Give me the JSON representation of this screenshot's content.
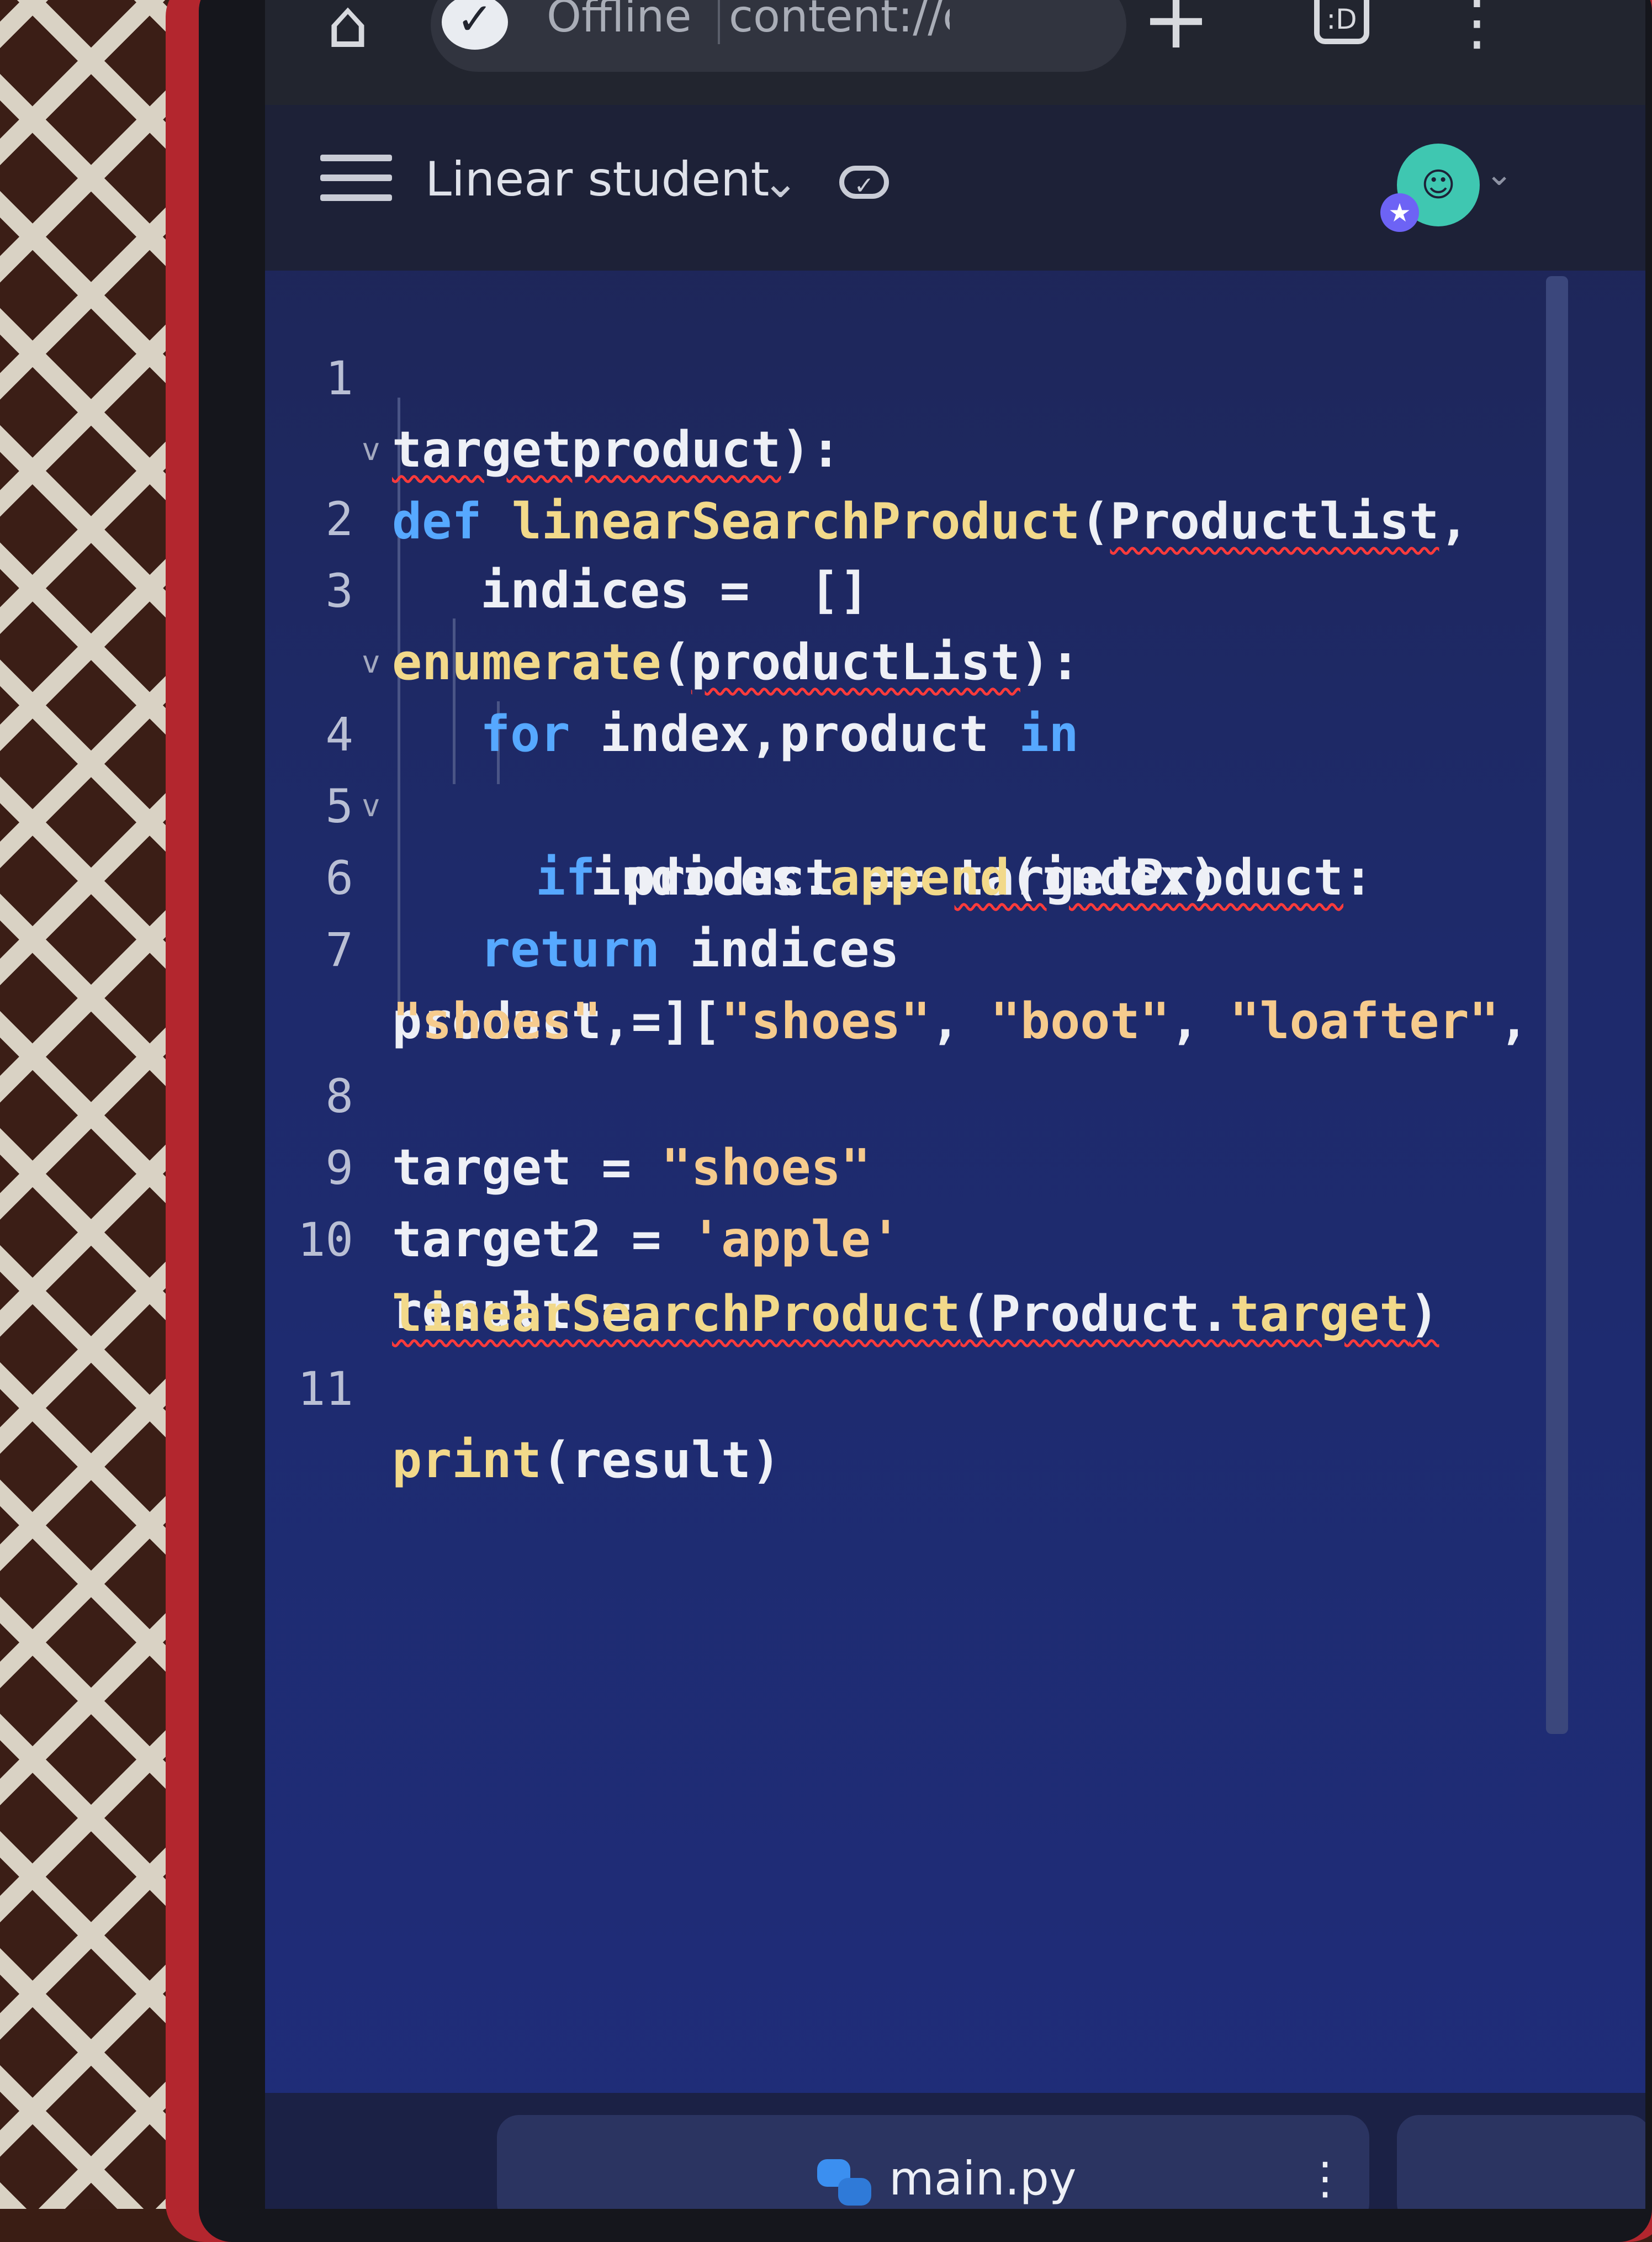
{
  "browser": {
    "status": "Offline",
    "url": "content://com.",
    "home_icon": "home-icon",
    "offline_icon": "check-circle-icon",
    "new_tab_icon": "plus-icon",
    "tabs_icon": "tab-switcher-icon",
    "tabs_count": ":D",
    "more_icon": "more-vert-icon"
  },
  "header": {
    "project_title": "Linear student",
    "menu_icon": "hamburger-icon",
    "dropdown_icon": "chevron-down-icon",
    "sync_icon": "cloud-check-icon"
  },
  "editor": {
    "line_numbers": [
      "1",
      "2",
      "3",
      "4",
      "5",
      "6",
      "7",
      "8",
      "9",
      "10",
      "11"
    ],
    "lines": [
      {
        "no": "1",
        "text": "def linearSearchProduct(Productlist,"
      },
      {
        "no": "",
        "text": "targetproduct):"
      },
      {
        "no": "2",
        "text": "indices = []"
      },
      {
        "no": "3",
        "text": "for index,product in"
      },
      {
        "no": "",
        "text": "enumerate(productList):"
      },
      {
        "no": "4",
        "text": "if product == targetProduct:"
      },
      {
        "no": "5",
        "text": "indices.append(index)"
      },
      {
        "no": "6",
        "text": "return indices"
      },
      {
        "no": "7",
        "text": "product = [\"shoes\", \"boot\", \"loafter\","
      },
      {
        "no": "",
        "text": "\"shoes\", ]"
      },
      {
        "no": "8",
        "text": "target = \"shoes\""
      },
      {
        "no": "9",
        "text": "target2 = 'apple'"
      },
      {
        "no": "10",
        "text": "result ="
      },
      {
        "no": "",
        "text": "linearSearchProduct(Product.target)"
      },
      {
        "no": "11",
        "text": "print(result)"
      }
    ]
  },
  "footer": {
    "filename": "main.py",
    "file_icon": "python-icon",
    "more_icon": "more-vert-icon"
  },
  "colors": {
    "keyword": "#56a8ff",
    "function": "#f2d98a",
    "string": "#f6cb8d",
    "error_underline": "#ff3b3b",
    "editor_bg": "#1e2a6a"
  }
}
